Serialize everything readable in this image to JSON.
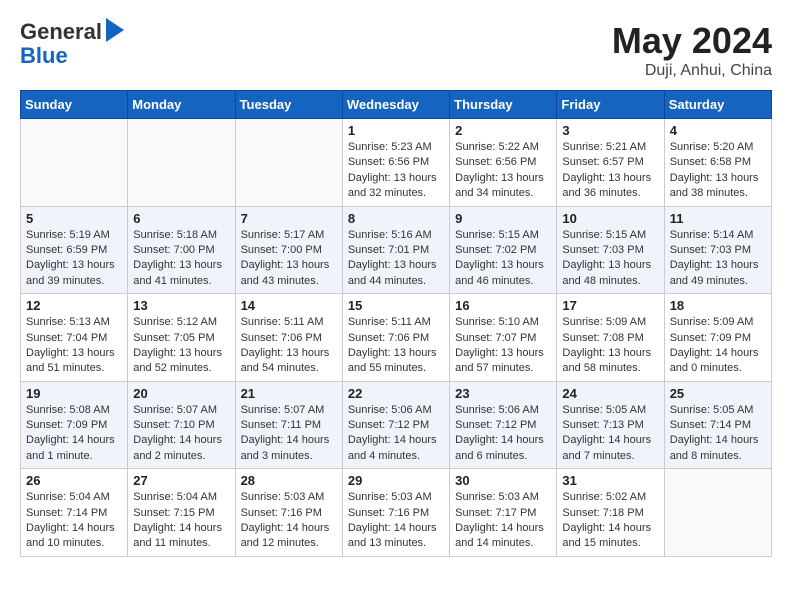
{
  "header": {
    "logo_line1": "General",
    "logo_line2": "Blue",
    "month": "May 2024",
    "location": "Duji, Anhui, China"
  },
  "days_of_week": [
    "Sunday",
    "Monday",
    "Tuesday",
    "Wednesday",
    "Thursday",
    "Friday",
    "Saturday"
  ],
  "weeks": [
    {
      "cells": [
        {
          "day": "",
          "empty": true
        },
        {
          "day": "",
          "empty": true
        },
        {
          "day": "",
          "empty": true
        },
        {
          "day": "1",
          "sunrise": "5:23 AM",
          "sunset": "6:56 PM",
          "daylight": "13 hours and 32 minutes."
        },
        {
          "day": "2",
          "sunrise": "5:22 AM",
          "sunset": "6:56 PM",
          "daylight": "13 hours and 34 minutes."
        },
        {
          "day": "3",
          "sunrise": "5:21 AM",
          "sunset": "6:57 PM",
          "daylight": "13 hours and 36 minutes."
        },
        {
          "day": "4",
          "sunrise": "5:20 AM",
          "sunset": "6:58 PM",
          "daylight": "13 hours and 38 minutes."
        }
      ]
    },
    {
      "cells": [
        {
          "day": "5",
          "sunrise": "5:19 AM",
          "sunset": "6:59 PM",
          "daylight": "13 hours and 39 minutes."
        },
        {
          "day": "6",
          "sunrise": "5:18 AM",
          "sunset": "7:00 PM",
          "daylight": "13 hours and 41 minutes."
        },
        {
          "day": "7",
          "sunrise": "5:17 AM",
          "sunset": "7:00 PM",
          "daylight": "13 hours and 43 minutes."
        },
        {
          "day": "8",
          "sunrise": "5:16 AM",
          "sunset": "7:01 PM",
          "daylight": "13 hours and 44 minutes."
        },
        {
          "day": "9",
          "sunrise": "5:15 AM",
          "sunset": "7:02 PM",
          "daylight": "13 hours and 46 minutes."
        },
        {
          "day": "10",
          "sunrise": "5:15 AM",
          "sunset": "7:03 PM",
          "daylight": "13 hours and 48 minutes."
        },
        {
          "day": "11",
          "sunrise": "5:14 AM",
          "sunset": "7:03 PM",
          "daylight": "13 hours and 49 minutes."
        }
      ]
    },
    {
      "cells": [
        {
          "day": "12",
          "sunrise": "5:13 AM",
          "sunset": "7:04 PM",
          "daylight": "13 hours and 51 minutes."
        },
        {
          "day": "13",
          "sunrise": "5:12 AM",
          "sunset": "7:05 PM",
          "daylight": "13 hours and 52 minutes."
        },
        {
          "day": "14",
          "sunrise": "5:11 AM",
          "sunset": "7:06 PM",
          "daylight": "13 hours and 54 minutes."
        },
        {
          "day": "15",
          "sunrise": "5:11 AM",
          "sunset": "7:06 PM",
          "daylight": "13 hours and 55 minutes."
        },
        {
          "day": "16",
          "sunrise": "5:10 AM",
          "sunset": "7:07 PM",
          "daylight": "13 hours and 57 minutes."
        },
        {
          "day": "17",
          "sunrise": "5:09 AM",
          "sunset": "7:08 PM",
          "daylight": "13 hours and 58 minutes."
        },
        {
          "day": "18",
          "sunrise": "5:09 AM",
          "sunset": "7:09 PM",
          "daylight": "14 hours and 0 minutes."
        }
      ]
    },
    {
      "cells": [
        {
          "day": "19",
          "sunrise": "5:08 AM",
          "sunset": "7:09 PM",
          "daylight": "14 hours and 1 minute."
        },
        {
          "day": "20",
          "sunrise": "5:07 AM",
          "sunset": "7:10 PM",
          "daylight": "14 hours and 2 minutes."
        },
        {
          "day": "21",
          "sunrise": "5:07 AM",
          "sunset": "7:11 PM",
          "daylight": "14 hours and 3 minutes."
        },
        {
          "day": "22",
          "sunrise": "5:06 AM",
          "sunset": "7:12 PM",
          "daylight": "14 hours and 4 minutes."
        },
        {
          "day": "23",
          "sunrise": "5:06 AM",
          "sunset": "7:12 PM",
          "daylight": "14 hours and 6 minutes."
        },
        {
          "day": "24",
          "sunrise": "5:05 AM",
          "sunset": "7:13 PM",
          "daylight": "14 hours and 7 minutes."
        },
        {
          "day": "25",
          "sunrise": "5:05 AM",
          "sunset": "7:14 PM",
          "daylight": "14 hours and 8 minutes."
        }
      ]
    },
    {
      "cells": [
        {
          "day": "26",
          "sunrise": "5:04 AM",
          "sunset": "7:14 PM",
          "daylight": "14 hours and 10 minutes."
        },
        {
          "day": "27",
          "sunrise": "5:04 AM",
          "sunset": "7:15 PM",
          "daylight": "14 hours and 11 minutes."
        },
        {
          "day": "28",
          "sunrise": "5:03 AM",
          "sunset": "7:16 PM",
          "daylight": "14 hours and 12 minutes."
        },
        {
          "day": "29",
          "sunrise": "5:03 AM",
          "sunset": "7:16 PM",
          "daylight": "14 hours and 13 minutes."
        },
        {
          "day": "30",
          "sunrise": "5:03 AM",
          "sunset": "7:17 PM",
          "daylight": "14 hours and 14 minutes."
        },
        {
          "day": "31",
          "sunrise": "5:02 AM",
          "sunset": "7:18 PM",
          "daylight": "14 hours and 15 minutes."
        },
        {
          "day": "",
          "empty": true
        }
      ]
    }
  ]
}
